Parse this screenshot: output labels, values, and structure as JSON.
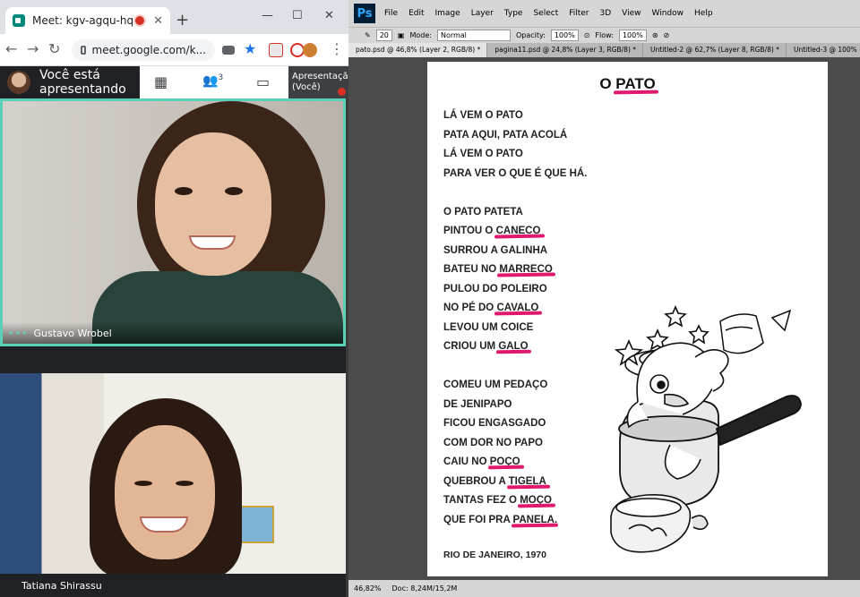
{
  "chrome": {
    "tab_title": "Meet: kgv-agqu-hqa",
    "close_glyph": "✕",
    "new_tab_glyph": "+",
    "url": "meet.google.com/k...",
    "window_buttons": [
      "—",
      "☐",
      "✕"
    ]
  },
  "meet": {
    "presenting_text": "Você está apresentando",
    "people_count": "3",
    "presentation_tile": "Apresentação (Você)",
    "participants": [
      {
        "name": "Gustavo Wrobel"
      },
      {
        "name": "Tatiana Shirassu"
      }
    ]
  },
  "photoshop": {
    "logo": "Ps",
    "menu": [
      "File",
      "Edit",
      "Image",
      "Layer",
      "Type",
      "Select",
      "Filter",
      "3D",
      "View",
      "Window",
      "Help"
    ],
    "options": {
      "brush_size": "20",
      "mode_label": "Mode:",
      "mode_value": "Normal",
      "opacity_label": "Opacity:",
      "opacity_value": "100%",
      "flow_label": "Flow:",
      "flow_value": "100%"
    },
    "doc_tabs": [
      "pato.psd @ 46,8% (Layer 2, RGB/8) *",
      "pagina11.psd @ 24,8% (Layer 3, RGB/8) *",
      "Untitled-2 @ 62,7% (Layer 8, RGB/8) *",
      "Untitled-3 @ 100% (Gra"
    ],
    "status": {
      "zoom": "46,82%",
      "doc": "Doc: 8,24M/15,2M"
    }
  },
  "poem": {
    "title_plain": "O",
    "title_hl": "PATO",
    "lines": [
      {
        "pre": "LÁ VEM O PATO"
      },
      {
        "pre": "PATA AQUI, PATA ACOLÁ"
      },
      {
        "pre": "LÁ VEM O PATO"
      },
      {
        "pre": "PARA VER O QUE É QUE HÁ."
      },
      {
        "gap": true
      },
      {
        "pre": "O PATO PATETA"
      },
      {
        "pre": "PINTOU O ",
        "hl": "CANECO"
      },
      {
        "pre": "SURROU A GALINHA"
      },
      {
        "pre": "BATEU NO ",
        "hl": "MARRECO"
      },
      {
        "pre": "PULOU DO POLEIRO"
      },
      {
        "pre": "NO PÉ DO ",
        "hl": "CAVALO"
      },
      {
        "pre": "LEVOU UM COICE"
      },
      {
        "pre": "CRIOU UM ",
        "hl": "GALO"
      },
      {
        "gap": true
      },
      {
        "pre": "COMEU UM PEDAÇO"
      },
      {
        "pre": "DE JENIPAPO"
      },
      {
        "pre": "FICOU ENGASGADO"
      },
      {
        "pre": "COM DOR NO PAPO"
      },
      {
        "pre": "CAIU NO ",
        "hl": "POÇO"
      },
      {
        "pre": "QUEBROU A ",
        "hl": "TIGELA"
      },
      {
        "pre": "TANTAS FEZ O ",
        "hl": "MOÇO"
      },
      {
        "pre": "QUE FOI PRA ",
        "hl": "PANELA",
        "post": "."
      }
    ],
    "place": "RIO DE JANEIRO, 1970"
  }
}
